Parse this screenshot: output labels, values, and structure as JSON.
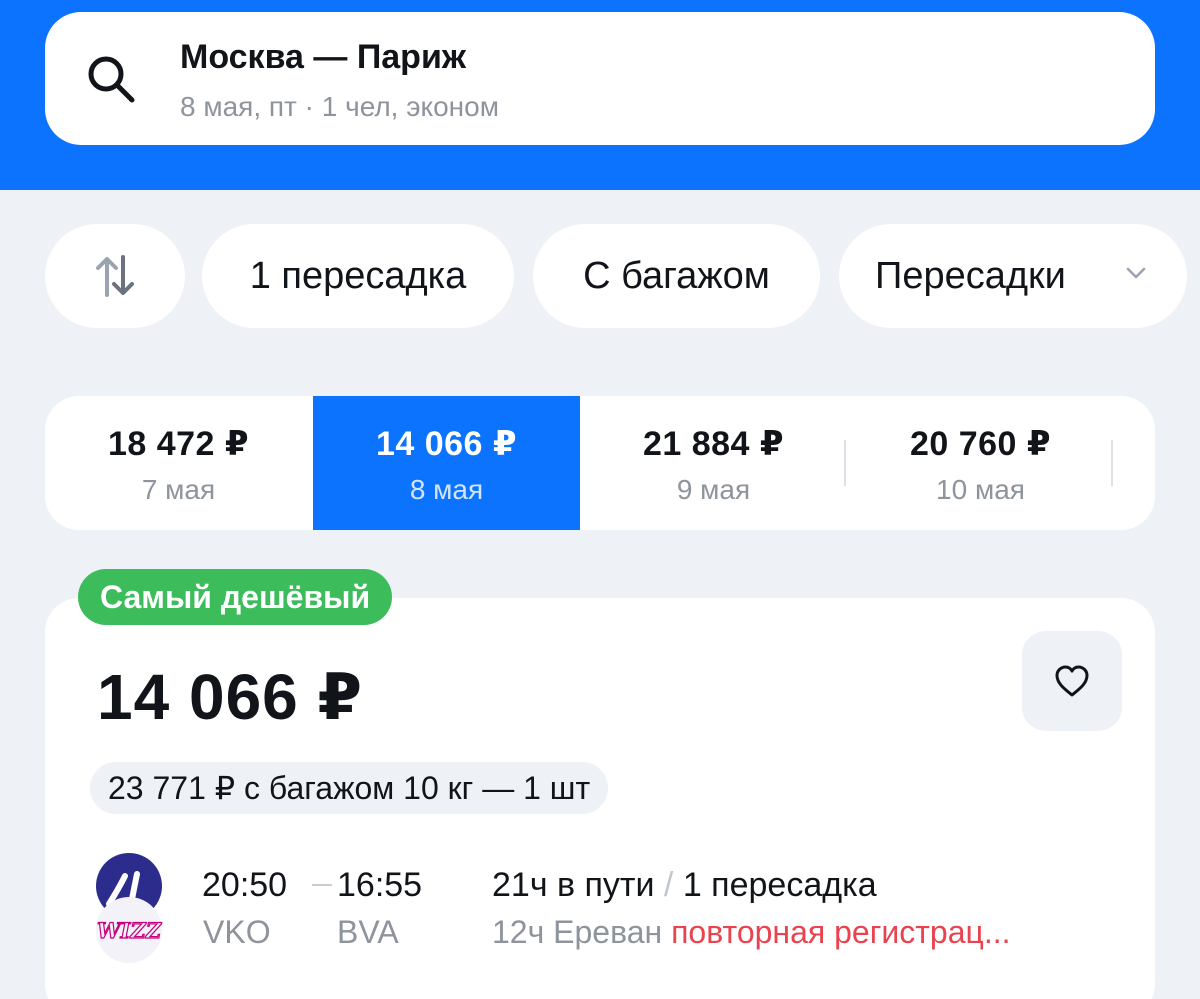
{
  "colors": {
    "brand_blue": "#0c73fe",
    "badge_green": "#3cbc5b",
    "warning_red": "#e8434f",
    "muted_gray": "#8d949c",
    "background": "#eef1f6"
  },
  "search": {
    "icon": "search-icon",
    "route": "Москва — Париж",
    "details": "8 мая, пт · 1 чел, эконом"
  },
  "filters": {
    "sort_icon": "sort-arrows-icon",
    "chips": [
      {
        "label": "1 пересадка"
      },
      {
        "label": "С багажом"
      },
      {
        "label": "Пересадки",
        "icon": "chevron-down-icon"
      }
    ]
  },
  "dates": [
    {
      "price": "18 472 ₽",
      "day": "7 мая",
      "selected": false
    },
    {
      "price": "14 066 ₽",
      "day": "8 мая",
      "selected": true
    },
    {
      "price": "21 884 ₽",
      "day": "9 мая",
      "selected": false
    },
    {
      "price": "20 760 ₽",
      "day": "10 мая",
      "selected": false
    }
  ],
  "result": {
    "badge": "Самый дешёвый",
    "price": "14 066 ₽",
    "favorite_icon": "heart-icon",
    "baggage_offer": "23 771 ₽ с багажом 10 кг — 1 шт",
    "airline_logo_text": "WIZZ",
    "departure_time": "20:50",
    "arrival_time": "16:55",
    "departure_code": "VKO",
    "arrival_code": "BVA",
    "duration": "21ч в пути",
    "slash": "/",
    "transfers": "1 пересадка",
    "stop_info": "12ч Ереван",
    "stop_warning": "повторная регистрац..."
  }
}
